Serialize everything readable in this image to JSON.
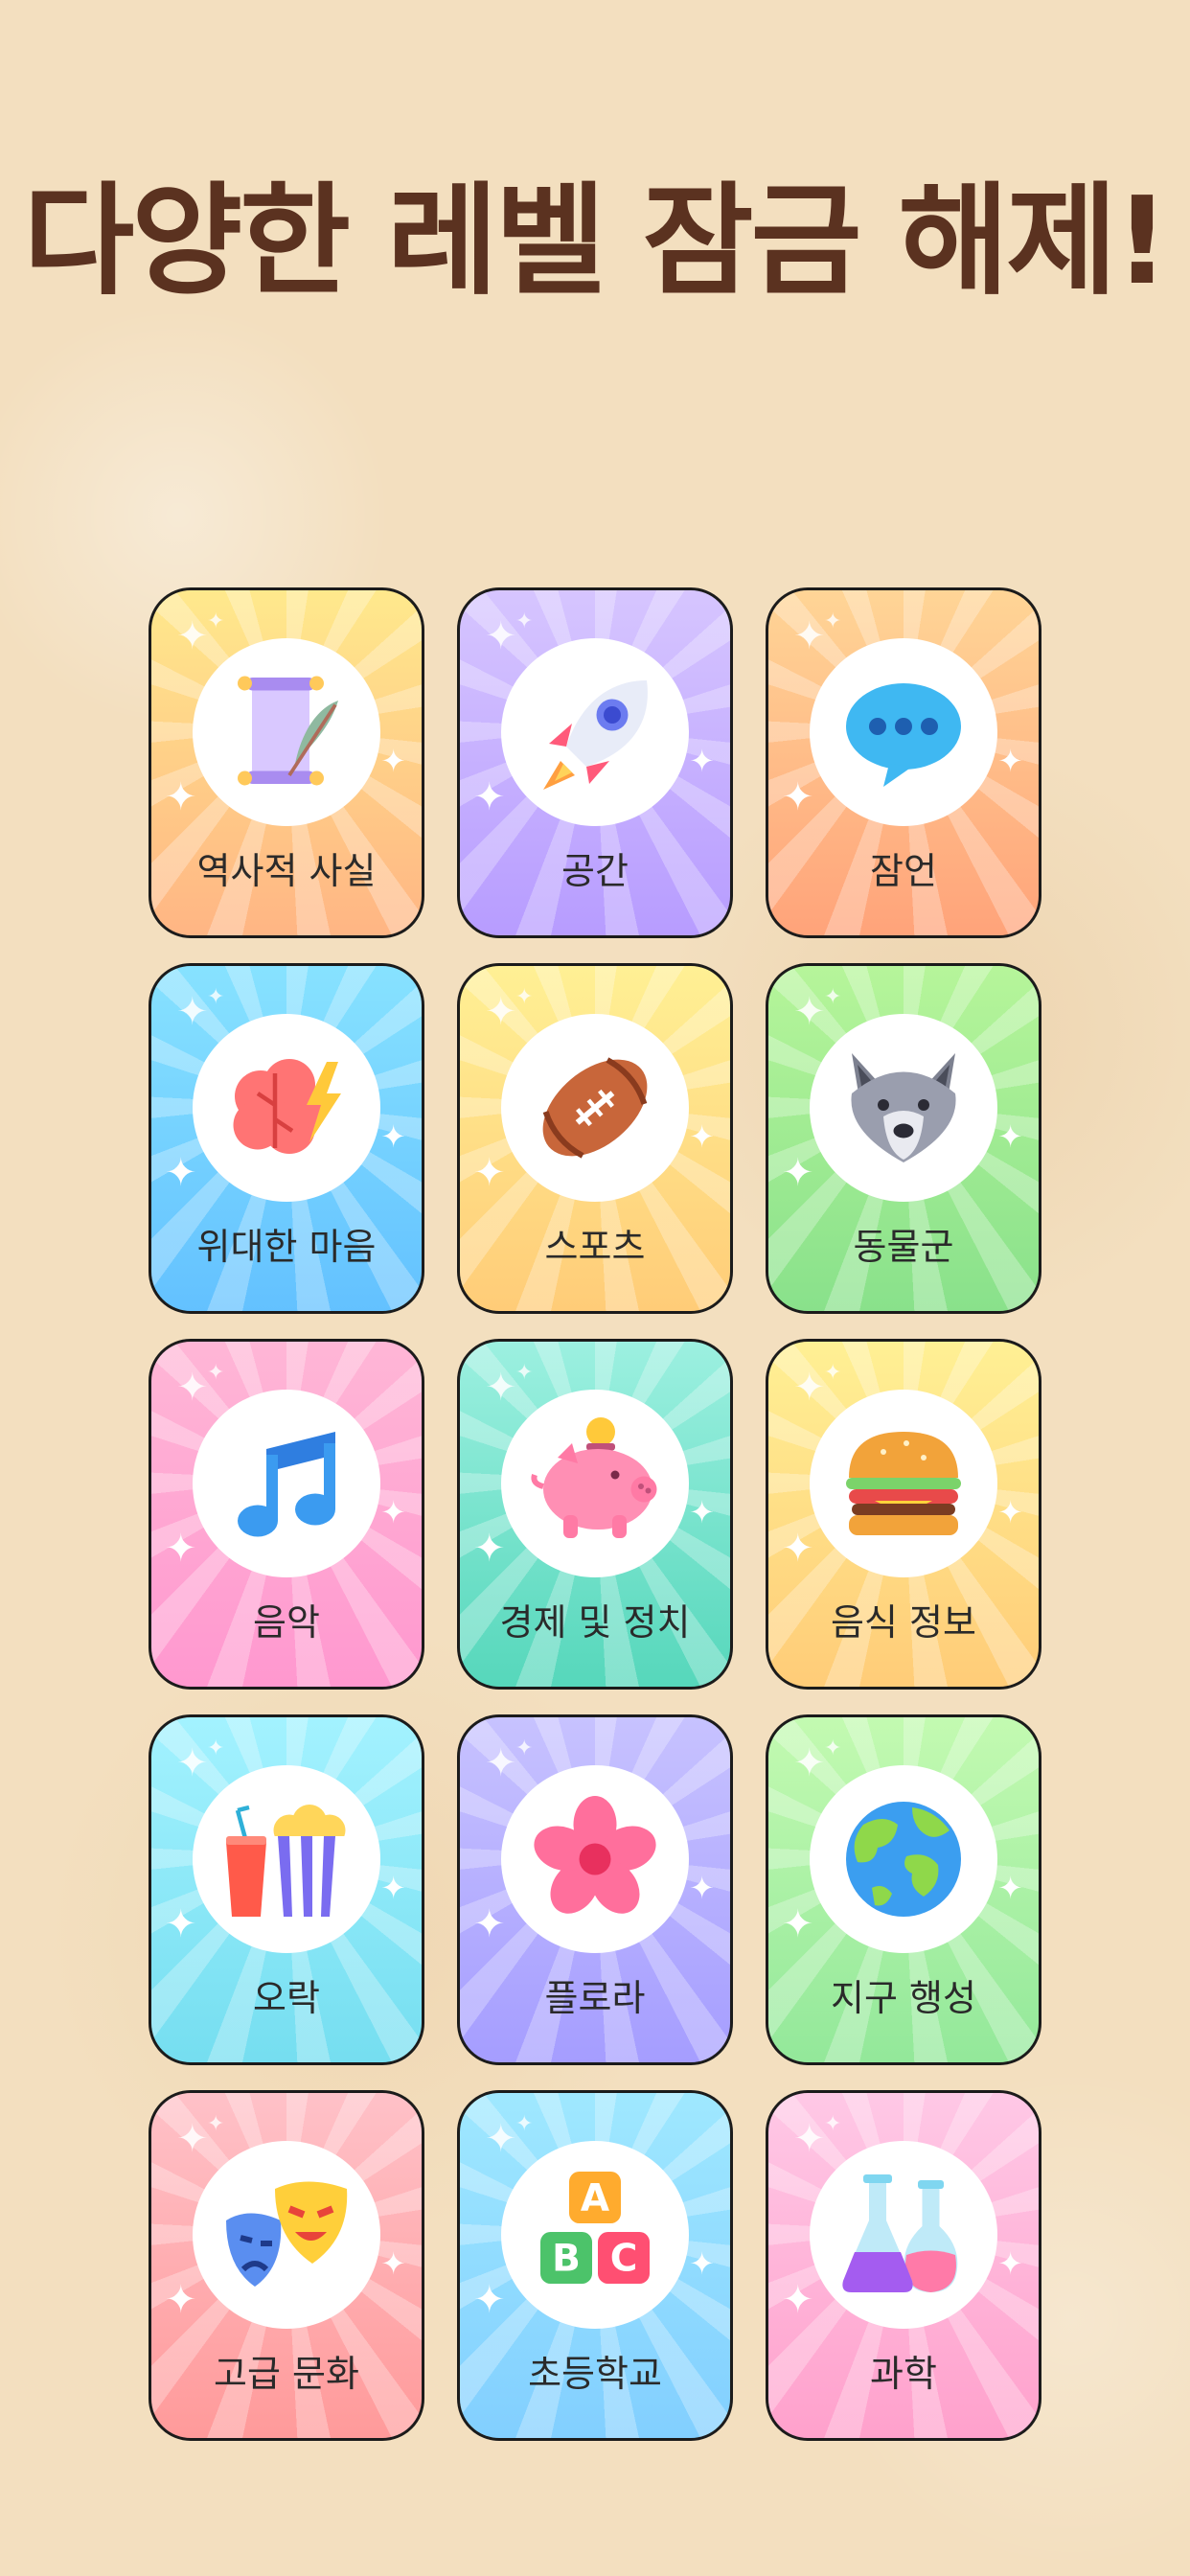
{
  "headline": "다양한 레벨 잠금 해제!",
  "categories": [
    {
      "label": "역사적 사실",
      "icon": "history-scroll-icon"
    },
    {
      "label": "공간",
      "icon": "rocket-icon"
    },
    {
      "label": "잠언",
      "icon": "speech-bubble-icon"
    },
    {
      "label": "위대한 마음",
      "icon": "brain-lightning-icon"
    },
    {
      "label": "스포츠",
      "icon": "football-icon"
    },
    {
      "label": "동물군",
      "icon": "wolf-icon"
    },
    {
      "label": "음악",
      "icon": "music-note-icon"
    },
    {
      "label": "경제 및 정치",
      "icon": "piggy-bank-icon"
    },
    {
      "label": "음식 정보",
      "icon": "burger-icon"
    },
    {
      "label": "오락",
      "icon": "popcorn-drink-icon"
    },
    {
      "label": "플로라",
      "icon": "flower-icon"
    },
    {
      "label": "지구 행성",
      "icon": "earth-icon"
    },
    {
      "label": "고급 문화",
      "icon": "theater-masks-icon"
    },
    {
      "label": "초등학교",
      "icon": "abc-blocks-icon"
    },
    {
      "label": "과학",
      "icon": "flasks-icon"
    }
  ],
  "abc_blocks": {
    "a": "A",
    "b": "B",
    "c": "C"
  },
  "colors": {
    "headline": "#5b3220",
    "background": "#f3dfbf",
    "card_border": "#1b1b1b",
    "label_text": "#2a2a2a"
  }
}
